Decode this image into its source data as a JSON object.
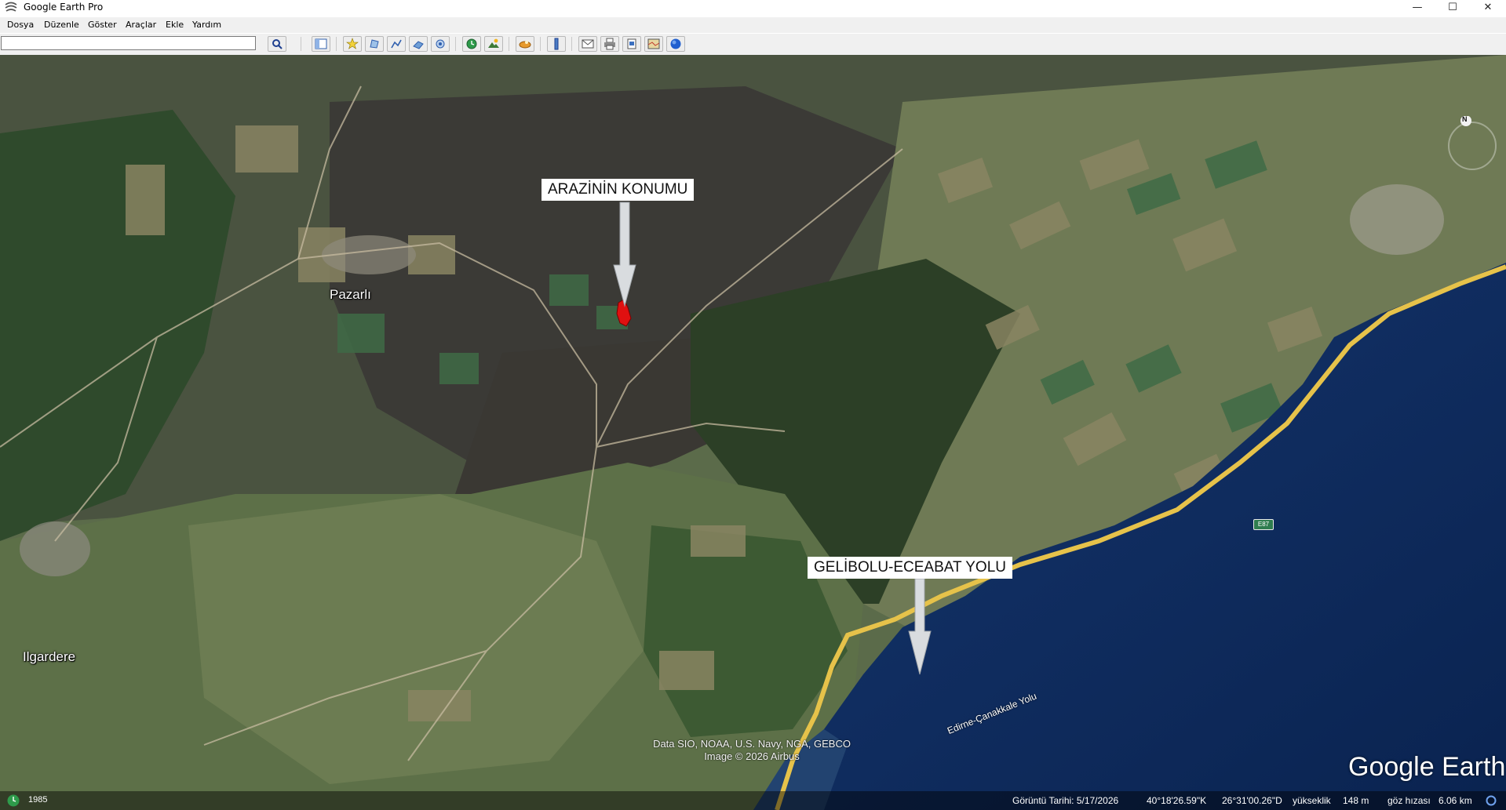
{
  "window": {
    "title": "Google Earth Pro",
    "minimize_glyph": "—",
    "maximize_glyph": "☐",
    "close_glyph": "✕"
  },
  "menu": {
    "items": [
      "Dosya",
      "Düzenle",
      "Göster",
      "Araçlar",
      "Ekle",
      "Yardım"
    ]
  },
  "search": {
    "value": "",
    "button_icon": "search-icon"
  },
  "toolbar": {
    "icons": [
      "sidebar-toggle-icon",
      "placemark-icon",
      "polygon-icon",
      "path-icon",
      "image-overlay-icon",
      "record-tour-icon",
      "historical-imagery-icon",
      "sunlight-icon",
      "planets-icon",
      "ruler-icon",
      "email-icon",
      "print-icon",
      "save-image-icon",
      "view-in-maps-icon",
      "earth-globe-icon"
    ]
  },
  "map": {
    "annotation_top": "ARAZİNİN KONUMU",
    "annotation_bottom": "GELİBOLU-ECEABAT YOLU",
    "place_pazarli": "Pazarlı",
    "place_ilgardere": "Ilgardere",
    "road_shield": "E87",
    "road_name": "Edirne-Çanakkale Yolu",
    "attribution_line1": "Data SIO, NOAA, U.S. Navy, NGA, GEBCO",
    "attribution_line2": "Image © 2026 Airbus",
    "logo": "Google Earth",
    "compass_letter": "N"
  },
  "status": {
    "historical_year": "1985",
    "imagery_date": "Görüntü Tarihi: 5/17/2026",
    "latitude": "40°18'26.59\"K",
    "longitude": "26°31'00.26\"D",
    "elevation_label": "yükseklik",
    "elevation_value": "148 m",
    "eye_alt_label": "göz hızası",
    "eye_alt_value": "6.06 km"
  },
  "colors": {
    "parcel_red": "#e01010",
    "sea": "#0d2a5c",
    "road_yellow": "#e6c24a"
  }
}
